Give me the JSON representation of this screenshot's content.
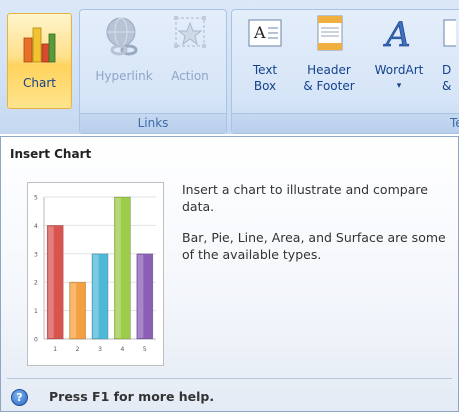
{
  "ribbon": {
    "chart_button": {
      "label": "Chart"
    },
    "links_group": {
      "label": "Links",
      "hyperlink": "Hyperlink",
      "action": "Action"
    },
    "text_group": {
      "label": "Te",
      "text_box": [
        "Text",
        "Box"
      ],
      "header_footer": [
        "Header",
        "& Footer"
      ],
      "wordart": "WordArt",
      "wordart_arrow": "▾",
      "clipped_item": [
        "D",
        "&"
      ]
    }
  },
  "tooltip": {
    "title": "Insert Chart",
    "description": "Insert a chart to illustrate and compare data.",
    "detail": "Bar, Pie, Line, Area, and Surface are some of the available types.",
    "help_text": "Press F1 for more help.",
    "help_icon": "?"
  },
  "chart_data": {
    "type": "bar",
    "categories": [
      "1",
      "2",
      "3",
      "4",
      "5"
    ],
    "values": [
      4,
      2,
      3,
      5,
      3
    ],
    "ylim": [
      0,
      5
    ],
    "yticks": [
      "0",
      "1",
      "2",
      "3",
      "4",
      "5"
    ],
    "colors": [
      "#d9534f",
      "#f5a040",
      "#4fb8d8",
      "#9ccc4a",
      "#8a5fb5"
    ],
    "grid": true
  }
}
